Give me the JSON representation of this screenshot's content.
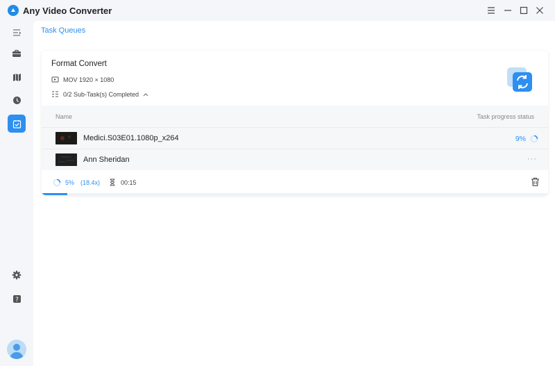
{
  "app": {
    "title": "Any Video Converter"
  },
  "sidebar": {
    "items": [
      {
        "icon": "toolbox-icon",
        "label": ""
      },
      {
        "icon": "map-icon",
        "label": ""
      },
      {
        "icon": "history-icon",
        "label": ""
      },
      {
        "icon": "task-queue-icon",
        "active": true
      }
    ]
  },
  "page": {
    "title": "Task Queues"
  },
  "task": {
    "title": "Format Convert",
    "format": "MOV 1920 × 1080",
    "subtasks": "0/2 Sub-Task(s) Completed",
    "table": {
      "col_name": "Name",
      "col_status": "Task progress status"
    },
    "rows": [
      {
        "name": "Medici.S03E01.1080p_x264",
        "progress": "9%",
        "state": "converting"
      },
      {
        "name": "Ann Sheridan",
        "progress": "",
        "state": "pending",
        "more": "···"
      }
    ],
    "footer": {
      "percent": "5%",
      "speed": "(18.4x)",
      "time": "00:15",
      "progress_fraction": 0.05
    }
  },
  "colors": {
    "accent": "#2d8ff0",
    "sidebar_bg": "#f4f6f9"
  }
}
